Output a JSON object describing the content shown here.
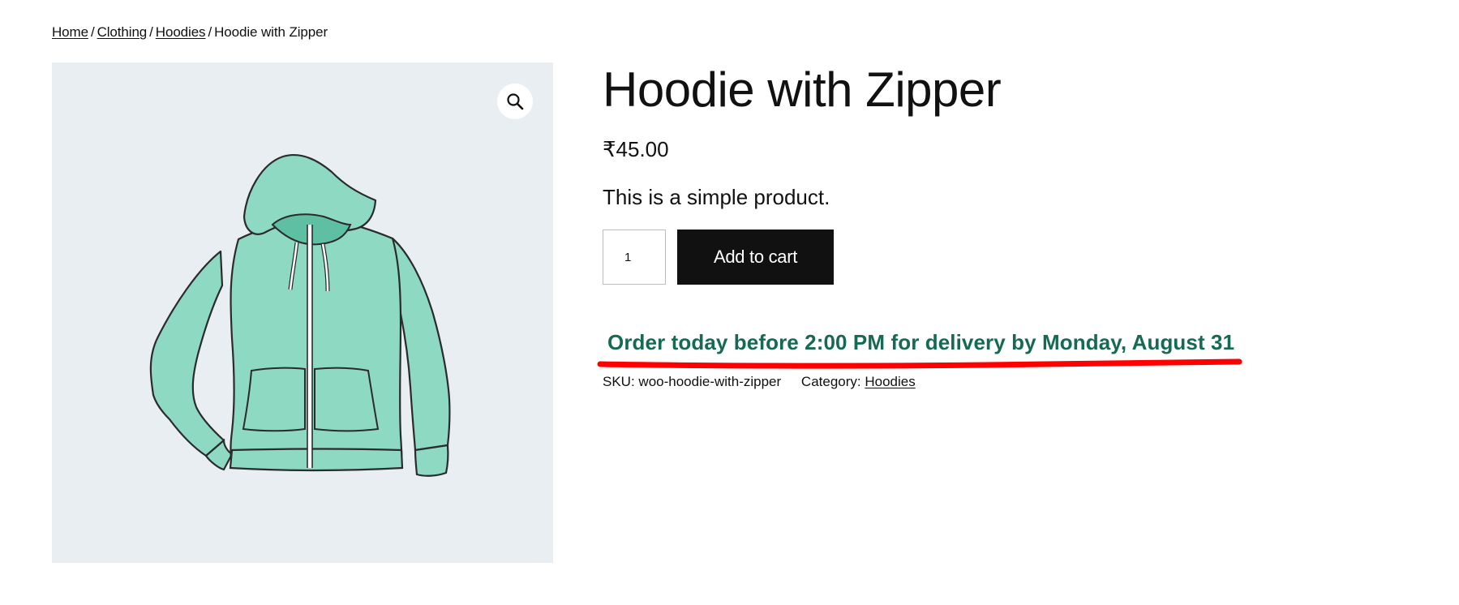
{
  "breadcrumb": {
    "items": [
      "Home",
      "Clothing",
      "Hoodies"
    ],
    "separator": "/",
    "current": "Hoodie with Zipper"
  },
  "gallery": {
    "zoom_icon": "magnifier-icon",
    "image_alt": "hoodie-illustration",
    "colors": {
      "background": "#e9eef2",
      "hoodie_fill": "#8ed9c2",
      "outline": "#2b2b2b"
    }
  },
  "product": {
    "title": "Hoodie with Zipper",
    "price": "₹45.00",
    "short_description": "This is a simple product.",
    "quantity": "1",
    "add_to_cart_label": "Add to cart"
  },
  "delivery": {
    "message": "Order today before 2:00 PM for delivery by Monday, August 31",
    "text_color": "#166a52",
    "mark_color": "#ff0000"
  },
  "meta": {
    "sku_label": "SKU:",
    "sku_value": "woo-hoodie-with-zipper",
    "category_label": "Category:",
    "category_value": "Hoodies"
  }
}
